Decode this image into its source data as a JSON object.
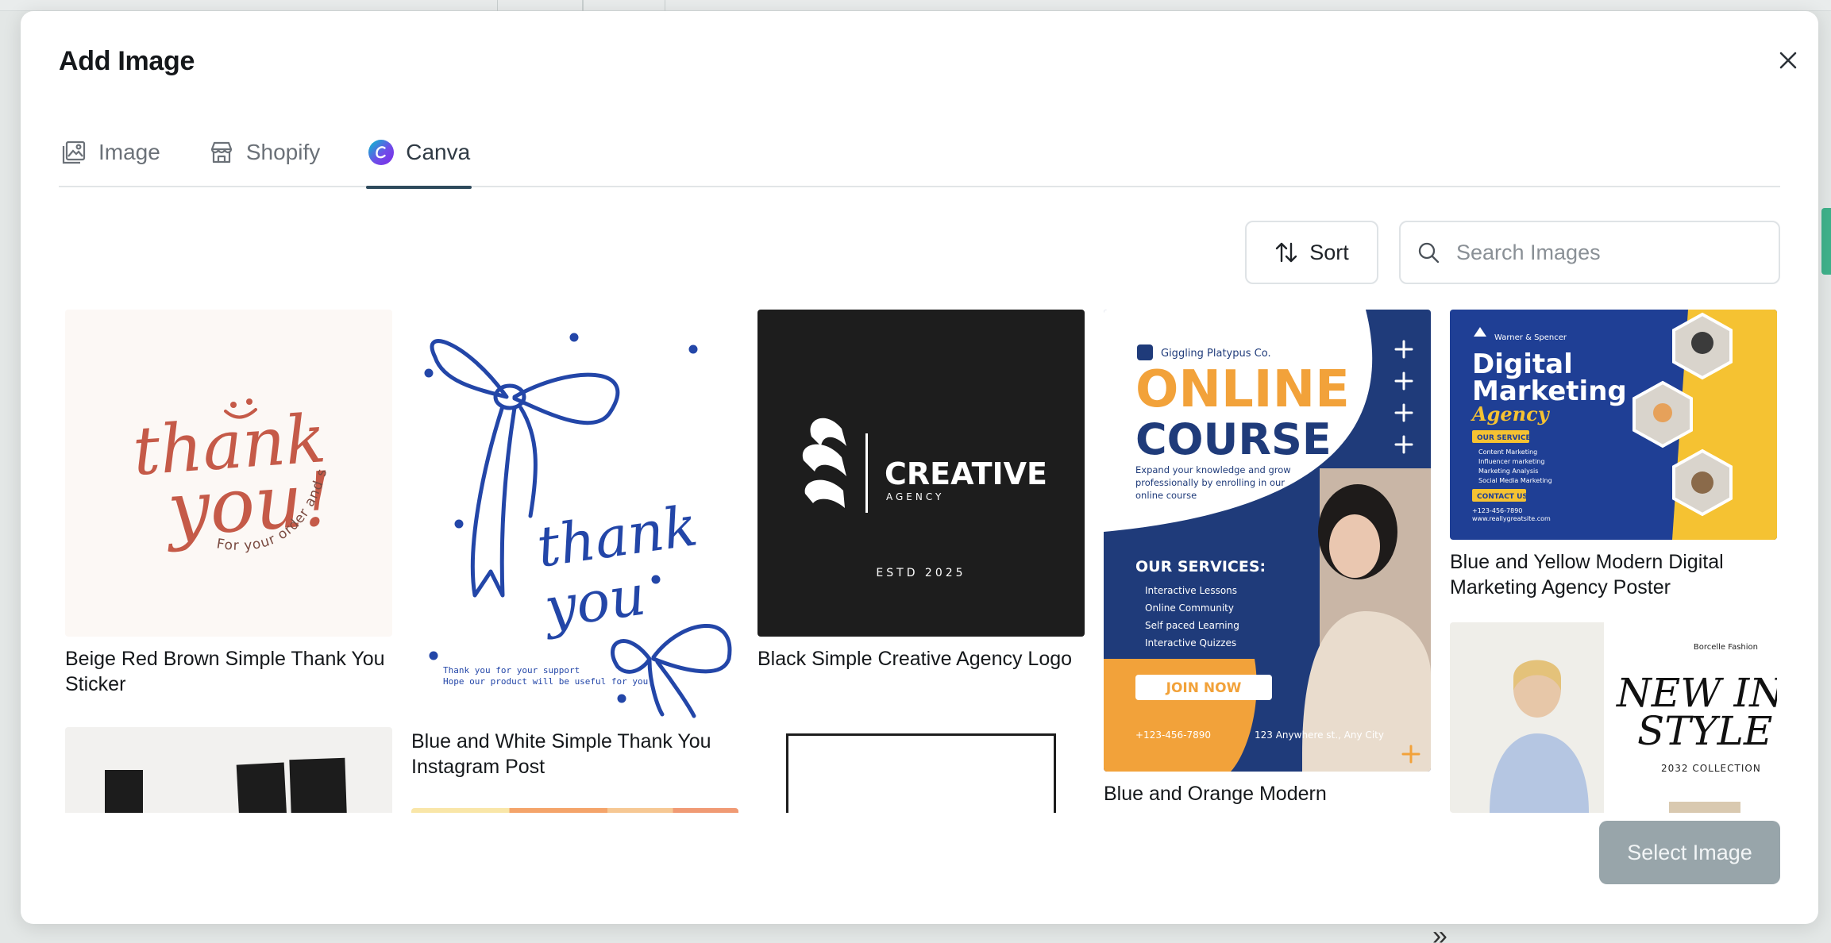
{
  "modal": {
    "title": "Add Image",
    "tabs": [
      {
        "label": "Image",
        "icon": "image-gallery-icon"
      },
      {
        "label": "Shopify",
        "icon": "store-icon"
      },
      {
        "label": "Canva",
        "icon": "canva-logo-icon"
      }
    ],
    "active_tab": "Canva",
    "sort_label": "Sort",
    "search_placeholder": "Search Images",
    "select_label": "Select Image"
  },
  "images": [
    {
      "title": "Beige Red Brown Simple Thank You Sticker",
      "art": {
        "line1": "thank",
        "line2": "you!",
        "arc": "For your order and support"
      }
    },
    {
      "title": "Blue and White Simple Thank You Instagram Post",
      "art": {
        "line1": "thank",
        "line2": "you",
        "small1": "Thank you for your support",
        "small2": "Hope our product will be useful for you."
      }
    },
    {
      "title": "Black Simple Creative Agency Logo",
      "art": {
        "brand": "CREATIVE",
        "sub": "AGENCY",
        "estd": "ESTD 2025"
      }
    },
    {
      "title": "Blue and Orange Modern",
      "art": {
        "company": "Giggling Platypus Co.",
        "h1": "ONLINE",
        "h2": "COURSE",
        "desc": "Expand your knowledge and grow professionally by enrolling in our online course",
        "services_title": "OUR SERVICES:",
        "services": [
          "Interactive Lessons",
          "Online Community",
          "Self paced Learning",
          "Interactive Quizzes"
        ],
        "cta": "JOIN NOW",
        "phone": "+123-456-7890",
        "address": "123 Anywhere st., Any City"
      }
    },
    {
      "title": "Blue and Yellow Modern Digital Marketing Agency Poster",
      "art": {
        "brand": "Warner & Spencer",
        "h1": "Digital",
        "h2": "Marketing",
        "h3": "Agency",
        "service_badge": "OUR SERVICE",
        "services": [
          "Content Marketing",
          "Influencer marketing",
          "Marketing Analysis",
          "Social Media Marketing"
        ],
        "contact_badge": "CONTACT US",
        "phone": "+123-456-7890",
        "web": "www.reallygreatsite.com"
      }
    },
    {
      "title": "",
      "art": {
        "brand": "Borcelle Fashion",
        "h1": "NEW IN",
        "h2": "STYLE",
        "collection": "2032 COLLECTION"
      }
    }
  ],
  "colors": {
    "accent_tab": "#2e4a5c",
    "select_button": "#98a5aa",
    "canva_gradient": [
      "#00c4cc",
      "#7d2ae8"
    ]
  }
}
